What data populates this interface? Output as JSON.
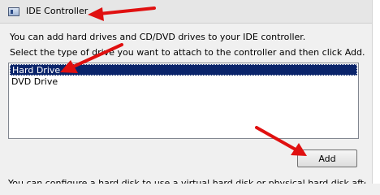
{
  "header": {
    "title": "IDE Controller",
    "icon": "ide-controller-icon"
  },
  "description": {
    "line1": "You can add hard drives and CD/DVD drives to your IDE controller.",
    "line2": "Select the type of drive you want to attach to the controller and then click Add."
  },
  "drive_types": {
    "items": [
      {
        "label": "Hard Drive",
        "selected": true
      },
      {
        "label": "DVD Drive",
        "selected": false
      }
    ]
  },
  "actions": {
    "add_label": "Add"
  },
  "footer": {
    "partial_text": "You can configure a hard disk to use a virtual hard disk or physical hard disk after"
  },
  "annotations": {
    "arrow_color": "#e01010",
    "arrow_count": 3
  }
}
